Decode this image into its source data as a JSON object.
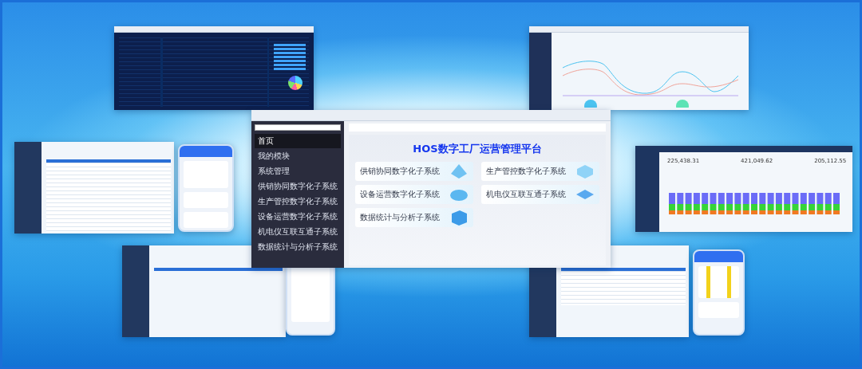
{
  "main_window": {
    "title": "HOS数字工厂运营管理平台",
    "sidebar": {
      "items": [
        {
          "label": "首页",
          "selected": true
        },
        {
          "label": "我的模块",
          "selected": false
        },
        {
          "label": "系统管理",
          "selected": false
        },
        {
          "label": "供销协同数字化子系统",
          "selected": false
        },
        {
          "label": "生产管控数字化子系统",
          "selected": false
        },
        {
          "label": "设备运营数字化子系统",
          "selected": false
        },
        {
          "label": "机电仪互联互通子系统",
          "selected": false
        },
        {
          "label": "数据统计与分析子系统",
          "selected": false
        }
      ]
    },
    "cards": [
      {
        "title": "供销协同数字化子系统",
        "kind": "pyramid"
      },
      {
        "title": "生产管控数字化子系统",
        "kind": "stack"
      },
      {
        "title": "设备运营数字化子系统",
        "kind": "disc"
      },
      {
        "title": "机电仪互联互通子系统",
        "kind": "plate"
      },
      {
        "title": "数据统计与分析子系统",
        "kind": "cube"
      }
    ]
  },
  "sales_screen": {
    "totals": [
      "225,438.31",
      "421,049.62",
      "205,112.55"
    ]
  }
}
